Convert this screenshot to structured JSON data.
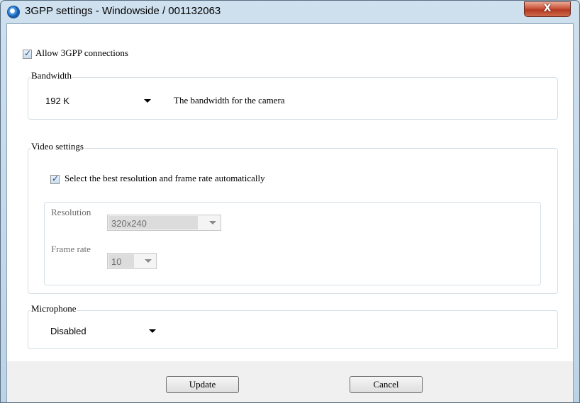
{
  "window": {
    "title": "3GPP settings - Windowside / 001132063",
    "close_symbol": "X"
  },
  "allow_3gpp": {
    "label": "Allow 3GPP connections",
    "checked": true
  },
  "bandwidth": {
    "group_title": "Bandwidth",
    "selected": "192 K",
    "description": "The bandwidth for the camera"
  },
  "video_settings": {
    "group_title": "Video settings",
    "auto": {
      "label": "Select the best resolution and frame rate automatically",
      "checked": true
    },
    "resolution": {
      "label": "Resolution",
      "selected": "320x240"
    },
    "frame_rate": {
      "label": "Frame rate",
      "selected": "10"
    }
  },
  "microphone": {
    "group_title": "Microphone",
    "selected": "Disabled"
  },
  "buttons": {
    "update": "Update",
    "cancel": "Cancel"
  }
}
